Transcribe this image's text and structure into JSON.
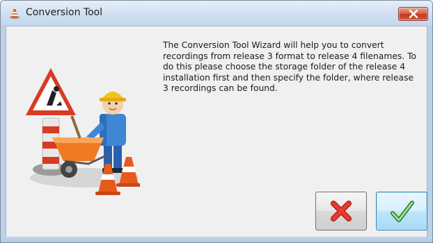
{
  "window": {
    "title": "Conversion Tool",
    "icon": "traffic-cone-icon"
  },
  "titlebar": {
    "close_icon": "close-x-icon",
    "close_color": "#c2381f"
  },
  "illustration": {
    "icon": "construction-worker-wheelbarrow-illustration"
  },
  "message": {
    "text": "The Conversion Tool Wizard will help you to convert recordings from release 3 format to release 4 filenames. To do this please choose the storage folder of the release 4 installation first and then specify the folder, where release 3 recordings can be found."
  },
  "buttons": {
    "cancel": {
      "icon": "red-x-icon",
      "color": "#d9251c"
    },
    "ok": {
      "icon": "green-check-icon",
      "color": "#3a9a3a"
    }
  }
}
